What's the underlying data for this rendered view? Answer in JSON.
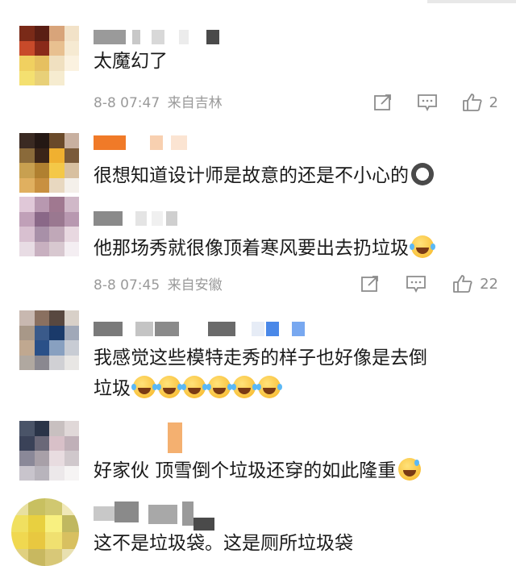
{
  "comments": [
    {
      "text": "太魔幻了",
      "time": "8-8 07:47",
      "location": "来自吉林",
      "likes": "2",
      "avatar_colors": [
        "#7a2a18",
        "#5a1e14",
        "#d8a47a",
        "#f2e2c8",
        "#c84a2a",
        "#8a2a1a",
        "#e8c090",
        "#f6ead2",
        "#f0d060",
        "#e6c060",
        "#f0e0c0",
        "#fbf2e0",
        "#f4e070",
        "#e8d078",
        "#f6ecd0",
        "#ffffff"
      ]
    },
    {
      "text": "很想知道设计师是故意的还是不小心的",
      "emoji_name": "husky-face-icon",
      "avatar_colors": [
        "#3a2a22",
        "#241814",
        "#6a4a2a",
        "#c8b0a0",
        "#8a6a3a",
        "#3a2418",
        "#f0b030",
        "#7a5a3a",
        "#c8a050",
        "#b08030",
        "#f4c848",
        "#d8c0a0",
        "#e0b060",
        "#c89040",
        "#e8d8c0",
        "#f4f0ea"
      ]
    },
    {
      "text": "他那场秀就很像顶着寒风要出去扔垃圾",
      "emoji_name": "laugh-cry-icon",
      "time": "8-8 07:45",
      "location": "来自安徽",
      "likes": "22",
      "avatar_colors": [
        "#e0c8d8",
        "#b898b0",
        "#a07890",
        "#d0b8c8",
        "#c0a0b8",
        "#8a6888",
        "#9a7890",
        "#b898b0",
        "#d8c0d0",
        "#a890a8",
        "#c0a8b8",
        "#e8d8e0",
        "#e8dce4",
        "#c8b0c0",
        "#d8c8d0",
        "#f4eef2"
      ]
    },
    {
      "text_line1": "我感觉这些模特走秀的样子也好像是去倒",
      "text_line2": "垃圾",
      "emoji_name": "laugh-cry-icon",
      "emoji_count": 6,
      "avatar_colors": [
        "#c8b8b0",
        "#8a7060",
        "#584840",
        "#d8d0c8",
        "#a89888",
        "#3a5a8a",
        "#1a3a6a",
        "#a0a8b8",
        "#c0a890",
        "#2a5088",
        "#88a0c0",
        "#c8ccd4",
        "#b0a8a0",
        "#8a8890",
        "#d0d0d4",
        "#e8e6e4"
      ]
    },
    {
      "text": "好家伙 顶雪倒个垃圾还穿的如此隆重",
      "emoji_name": "grinning-sweat-icon",
      "avatar_colors": [
        "#4a5468",
        "#2a3448",
        "#c8c0c0",
        "#e0d8d8",
        "#3a4258",
        "#6a6878",
        "#d8c0c8",
        "#c0b0b8",
        "#8a8898",
        "#a8a0a8",
        "#e8dce0",
        "#d0c8cc",
        "#c8c4cc",
        "#b8b4bc",
        "#ece8ea",
        "#f6f4f4"
      ]
    },
    {
      "text": "这不是垃圾袋。这是厕所垃圾袋",
      "avatar_colors": [
        "#e8e0a0",
        "#c8c060",
        "#d0c870",
        "#f0e8b8",
        "#f0e060",
        "#e8d040",
        "#f8f080",
        "#c0b860",
        "#f0d850",
        "#e8c840",
        "#f0e070",
        "#d8c060",
        "#e0d080",
        "#c8b860",
        "#d8c878",
        "#e8e0b0"
      ]
    }
  ]
}
